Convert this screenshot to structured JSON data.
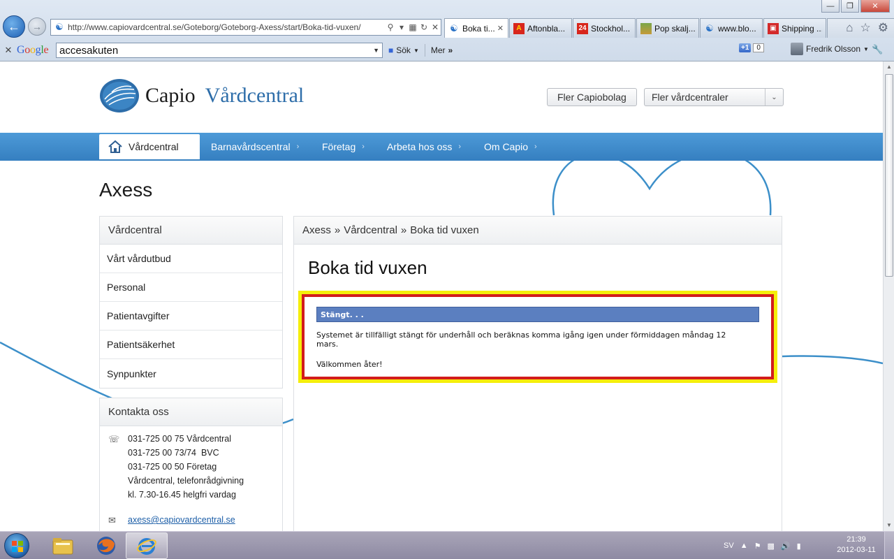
{
  "browser": {
    "url": "http://www.capiovardcentral.se/Goteborg/Goteborg-Axess/start/Boka-tid-vuxen/",
    "tabs": [
      {
        "label": "Boka ti...",
        "active": true,
        "icon": "ie-icon"
      },
      {
        "label": "Aftonbla...",
        "active": false,
        "icon": "aftonbladet-icon"
      },
      {
        "label": "Stockhol...",
        "active": false,
        "icon": "24-icon"
      },
      {
        "label": "Pop skalj...",
        "active": false,
        "icon": "photo-icon"
      },
      {
        "label": "www.blo...",
        "active": false,
        "icon": "ie-icon"
      },
      {
        "label": "Shipping ...",
        "active": false,
        "icon": "cart-icon"
      }
    ]
  },
  "google_toolbar": {
    "logo": "Google",
    "search_value": "accesakuten",
    "search_label": "Sök",
    "more_label": "Mer",
    "plus_one": "+1",
    "plus_one_count": "0",
    "user_name": "Fredrik Olsson"
  },
  "site": {
    "logo_word1": "Capio",
    "logo_word2": "Vårdcentral",
    "fler_capiobolag": "Fler Capiobolag",
    "fler_vardcentraler": "Fler vårdcentraler",
    "nav": [
      {
        "label": "Vårdcentral",
        "home": true
      },
      {
        "label": "Barnavårdscentral"
      },
      {
        "label": "Företag"
      },
      {
        "label": "Arbeta hos oss"
      },
      {
        "label": "Om Capio"
      }
    ],
    "heading": "Axess"
  },
  "sidebar": {
    "title": "Vårdcentral",
    "items": [
      {
        "label": "Vårt vårdutbud"
      },
      {
        "label": "Personal"
      },
      {
        "label": "Patientavgifter"
      },
      {
        "label": "Patientsäkerhet"
      },
      {
        "label": "Synpunkter"
      }
    ]
  },
  "contact": {
    "title": "Kontakta oss",
    "lines": [
      "031-725 00 75 Vårdcentral",
      "031-725 00 73/74  BVC",
      "031-725 00 50 Företag",
      "Vårdcentral, telefonrådgivning",
      "kl. 7.30-16.45 helgfri vardag"
    ],
    "email": "axess@capiovardcentral.se"
  },
  "content": {
    "breadcrumb": [
      "Axess",
      "»",
      "Vårdcentral",
      "»",
      "Boka tid vuxen"
    ],
    "title": "Boka tid vuxen",
    "notice_header": "Stängt. . .",
    "notice_text": "Systemet är tillfälligt stängt för underhåll och beräknas komma igång igen under förmiddagen måndag 12 mars.",
    "notice_welcome": "Välkommen åter!"
  },
  "taskbar": {
    "language": "SV",
    "time": "21:39",
    "date": "2012-03-11"
  },
  "colors": {
    "nav_blue": "#4289cc",
    "notice_outer": "#f5ee0b",
    "notice_inner": "#d21c1c",
    "notice_bar": "#5b7fc0",
    "logo_blue": "#2d6da9"
  }
}
